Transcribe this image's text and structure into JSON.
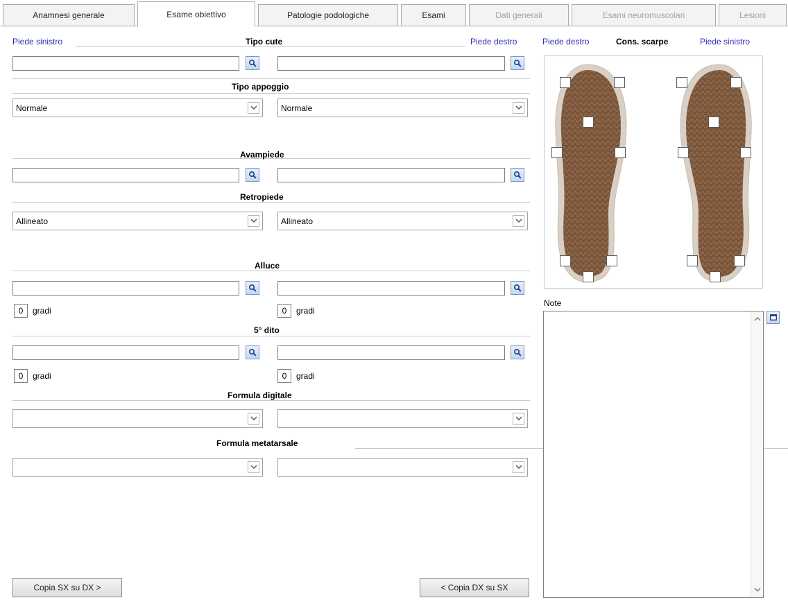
{
  "tabs": [
    {
      "label": "Anamnesi generale",
      "state": "normal"
    },
    {
      "label": "Esame obiettivo",
      "state": "active"
    },
    {
      "label": "Patologie podologiche",
      "state": "normal"
    },
    {
      "label": "Esami",
      "state": "normal"
    },
    {
      "label": "Dati generali",
      "state": "disabled"
    },
    {
      "label": "Esami neuromuscolari",
      "state": "disabled"
    },
    {
      "label": "Lesioni",
      "state": "disabled"
    }
  ],
  "header": {
    "left_link": "Piede sinistro",
    "right_link": "Piede destro"
  },
  "sections": {
    "tipo_cute": "Tipo cute",
    "tipo_appoggio": "Tipo appoggio",
    "avampiede": "Avampiede",
    "retropiede": "Retropiede",
    "alluce": "Alluce",
    "quinto_dito": "5° dito",
    "formula_digitale": "Formula digitale",
    "formula_metatarsale": "Formula metatarsale"
  },
  "fields": {
    "tipo_cute_left": "",
    "tipo_cute_right": "",
    "tipo_appoggio_left": "Normale",
    "tipo_appoggio_right": "Normale",
    "avampiede_left": "",
    "avampiede_right": "",
    "retropiede_left": "Allineato",
    "retropiede_right": "Allineato",
    "alluce_left": "",
    "alluce_right": "",
    "alluce_gradi_left": "0",
    "alluce_gradi_right": "0",
    "quinto_left": "",
    "quinto_right": "",
    "quinto_gradi_left": "0",
    "quinto_gradi_right": "0",
    "formula_digitale_left": "",
    "formula_digitale_right": "",
    "formula_metatarsale_left": "",
    "formula_metatarsale_right": ""
  },
  "units": {
    "gradi": "gradi"
  },
  "buttons": {
    "copy_sx_dx": "Copia SX su DX >",
    "copy_dx_sx": "< Copia DX su SX"
  },
  "shoes": {
    "left_link": "Piede destro",
    "title": "Cons. scarpe",
    "right_link": "Piede sinistro"
  },
  "notes": {
    "label": "Note",
    "value": ""
  },
  "colors": {
    "link": "#2b2bb4",
    "sole": "#7a5539",
    "sole_rim": "#d9cfc4"
  },
  "icons": {
    "search": "magnifier-icon",
    "dropdown": "chevron-down-icon",
    "maximize": "maximize-icon",
    "scroll_up": "scroll-up-icon",
    "scroll_down": "scroll-down-icon"
  }
}
